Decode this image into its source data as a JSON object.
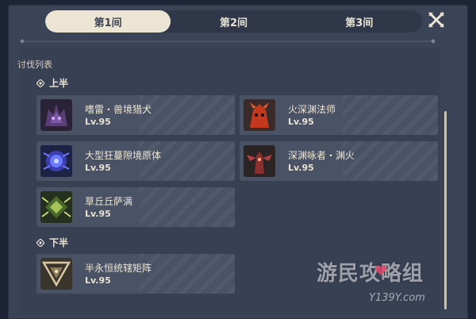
{
  "tabs": [
    {
      "label": "第1间",
      "active": true
    },
    {
      "label": "第2间",
      "active": false
    },
    {
      "label": "第3间",
      "active": false
    }
  ],
  "list_title": "讨伐列表",
  "sections": [
    {
      "title": "上半",
      "enemies": [
        {
          "name": "嗜雷・兽境猎犬",
          "level": "Lv.95",
          "icon": "rifthound-icon"
        },
        {
          "name": "火深渊法师",
          "level": "Lv.95",
          "icon": "pyro-abyss-mage-icon"
        },
        {
          "name": "大型狂蔓隙境原体",
          "level": "Lv.95",
          "icon": "overgrown-rift-icon"
        },
        {
          "name": "深渊咏者・渊火",
          "level": "Lv.95",
          "icon": "abyss-herald-icon"
        },
        {
          "name": "草丘丘萨满",
          "level": "Lv.95",
          "icon": "dendro-samachurl-icon"
        }
      ]
    },
    {
      "title": "下半",
      "enemies": [
        {
          "name": "半永恒统辖矩阵",
          "level": "Lv.95",
          "icon": "perpetual-matrix-icon"
        }
      ]
    }
  ],
  "watermark": {
    "main": "游民攻略组",
    "sub": "Y139Y.com"
  },
  "colors": {
    "background": "#3b4357",
    "card": "#4a5266",
    "tab_active": "#ece5d3",
    "text": "#ece5d3"
  }
}
